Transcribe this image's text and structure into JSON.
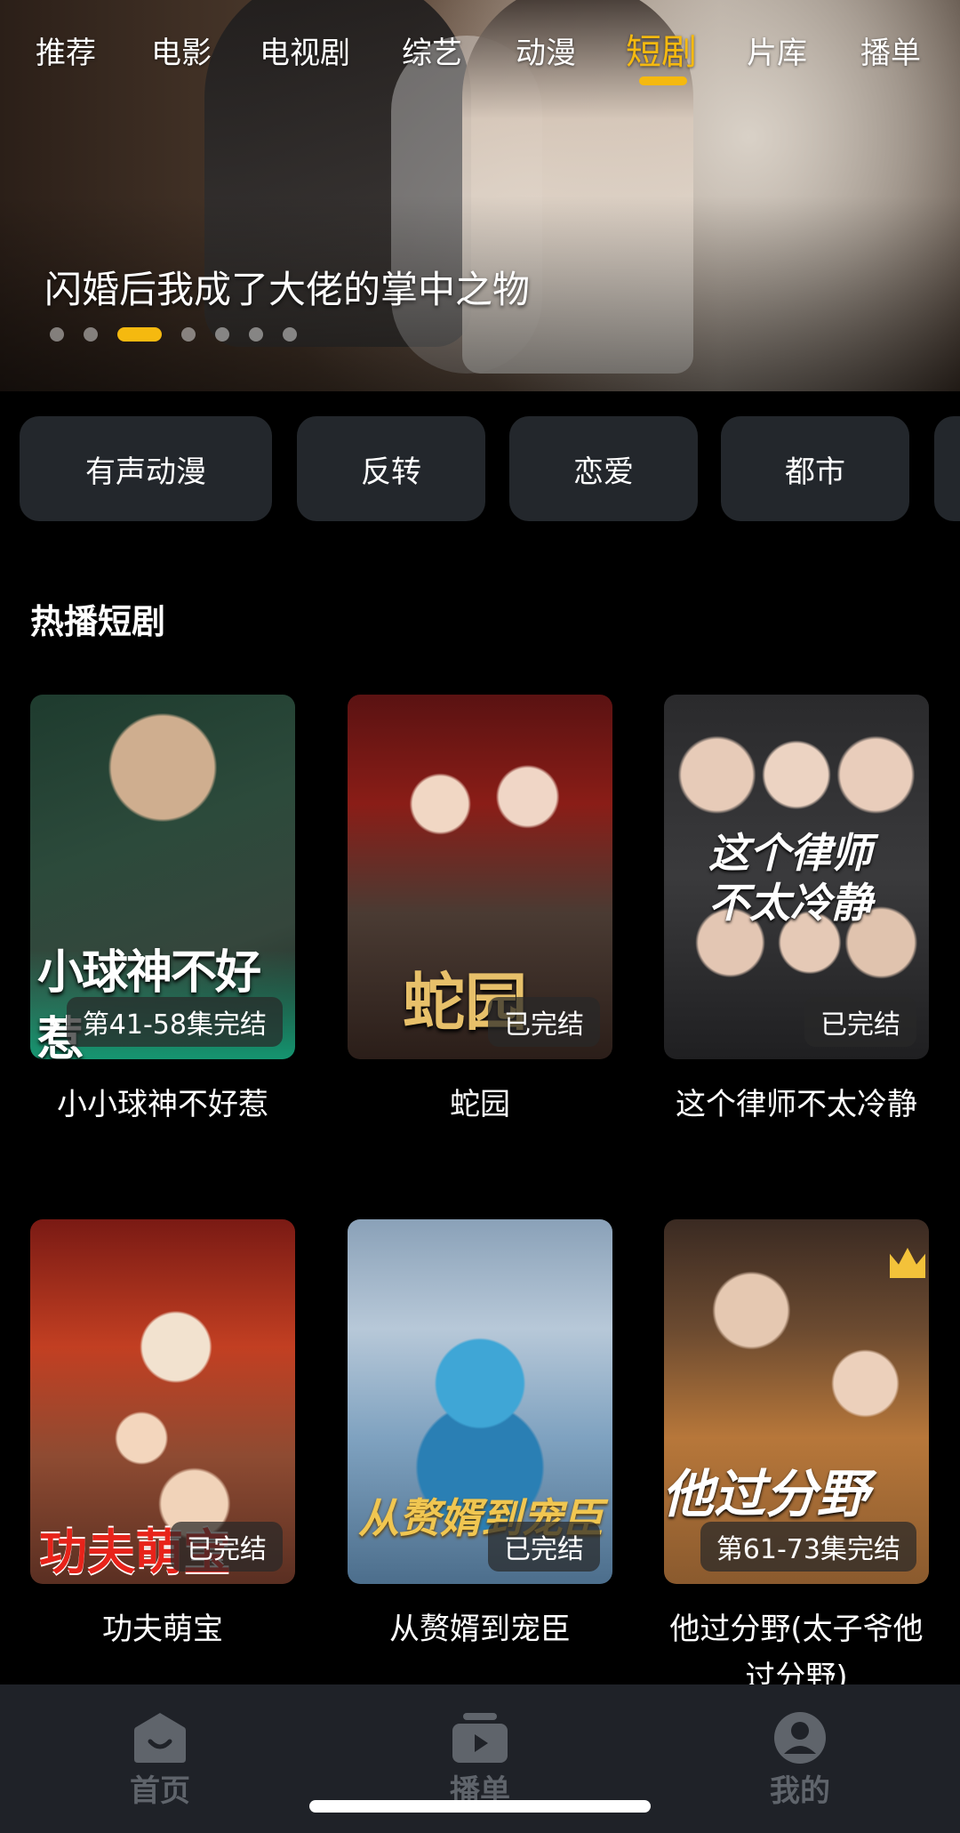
{
  "top_tabs": [
    {
      "label": "推荐",
      "active": false
    },
    {
      "label": "电影",
      "active": false
    },
    {
      "label": "电视剧",
      "active": false
    },
    {
      "label": "综艺",
      "active": false
    },
    {
      "label": "动漫",
      "active": false
    },
    {
      "label": "短剧",
      "active": true
    },
    {
      "label": "片库",
      "active": false
    },
    {
      "label": "播单",
      "active": false
    }
  ],
  "hero": {
    "title": "闪婚后我成了大佬的掌中之物",
    "slide_count": 7,
    "active_slide": 2
  },
  "categories": [
    "有声动漫",
    "反转",
    "恋爱",
    "都市"
  ],
  "section": {
    "title": "热播短剧"
  },
  "dramas": [
    {
      "title": "小小球神不好惹",
      "badge": "第41-58集完结",
      "poster_text": "小球神不好惹"
    },
    {
      "title": "蛇园",
      "badge": "已完结",
      "poster_text": "蛇园"
    },
    {
      "title": "这个律师不太冷静",
      "badge": "已完结",
      "poster_text": "这个律师不太冷静"
    },
    {
      "title": "功夫萌宝",
      "badge": "已完结",
      "poster_text": "功夫萌宝"
    },
    {
      "title": "从赘婿到宠臣",
      "badge": "已完结",
      "poster_text": "从赘婿到宠臣"
    },
    {
      "title": "他过分野(太子爷他过分野)",
      "badge": "第61-73集完结",
      "poster_text": "他过分野"
    }
  ],
  "bottom_nav": [
    {
      "label": "首页",
      "icon": "home-icon"
    },
    {
      "label": "播单",
      "icon": "playlist-icon"
    },
    {
      "label": "我的",
      "icon": "profile-icon"
    }
  ],
  "colors": {
    "accent": "#f5b90f",
    "chip_bg": "#23272c",
    "nav_bg": "#1f2228",
    "nav_icon": "#5f646b"
  }
}
